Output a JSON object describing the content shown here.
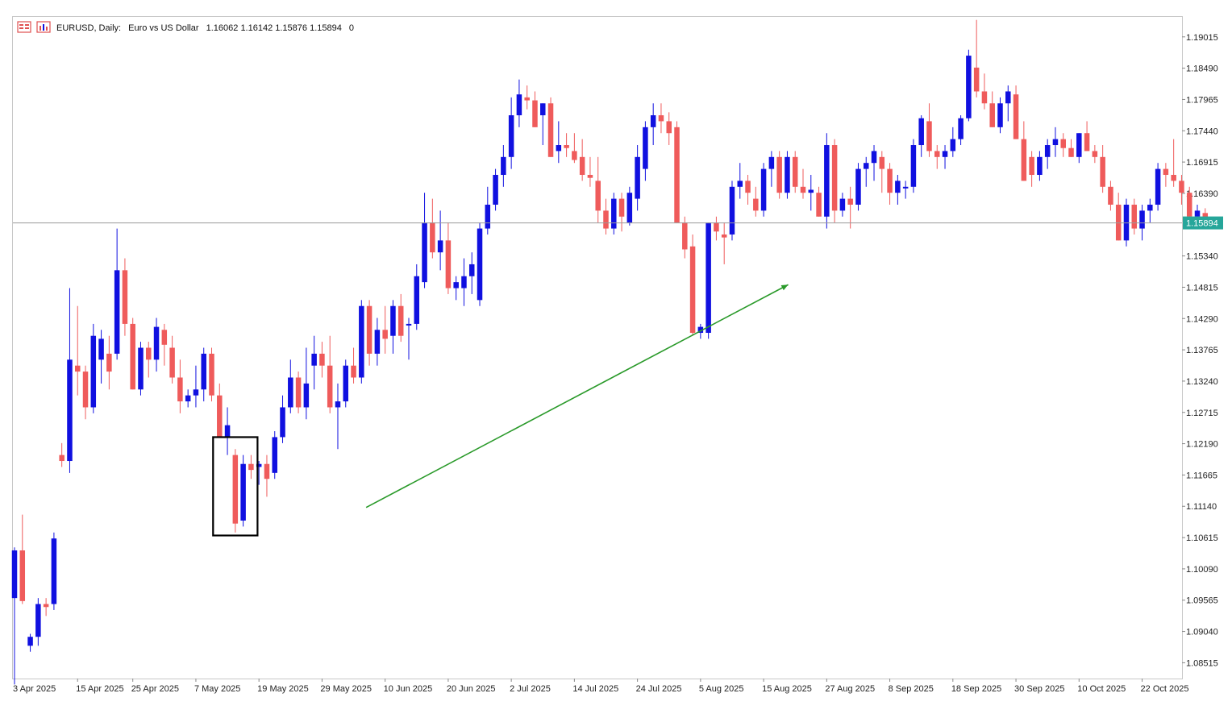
{
  "header": {
    "symbol_label": "EURUSD, Daily:",
    "description": "Euro vs US Dollar",
    "ohlc_text": "1.16062 1.16142 1.15876 1.15894",
    "volume_text": "0"
  },
  "icons": [
    "chart-menu-icon",
    "indicator-icon"
  ],
  "colors": {
    "bull": "#1010e0",
    "bear": "#ef5b5b",
    "price_line": "#9a9a9a",
    "price_label_bg": "#26a69a",
    "trend_arrow": "#2a9a2a",
    "highlight_box": "#000000"
  },
  "chart_data": {
    "type": "candlestick",
    "ylim": [
      1.0825,
      1.1935
    ],
    "y_ticks": [
      1.19015,
      1.1849,
      1.17965,
      1.1744,
      1.16915,
      1.1639,
      1.1534,
      1.14815,
      1.1429,
      1.13765,
      1.1324,
      1.12715,
      1.1219,
      1.11665,
      1.1114,
      1.10615,
      1.1009,
      1.09565,
      1.0904,
      1.08515
    ],
    "y_tick_labels": [
      "1.19015",
      "1.18490",
      "1.17965",
      "1.17440",
      "1.16915",
      "1.16390",
      "1.15340",
      "1.14815",
      "1.14290",
      "1.13765",
      "1.13240",
      "1.12715",
      "1.12190",
      "1.11665",
      "1.11140",
      "1.10615",
      "1.10090",
      "1.09565",
      "1.09040",
      "1.08515"
    ],
    "current_price": 1.15894,
    "current_price_label": "1.15894",
    "x_labels": [
      {
        "index": 0,
        "label": "3 Apr 2025"
      },
      {
        "index": 8,
        "label": "15 Apr 2025"
      },
      {
        "index": 15,
        "label": "25 Apr 2025"
      },
      {
        "index": 23,
        "label": "7 May 2025"
      },
      {
        "index": 31,
        "label": "19 May 2025"
      },
      {
        "index": 39,
        "label": "29 May 2025"
      },
      {
        "index": 47,
        "label": "10 Jun 2025"
      },
      {
        "index": 55,
        "label": "20 Jun 2025"
      },
      {
        "index": 63,
        "label": "2 Jul 2025"
      },
      {
        "index": 71,
        "label": "14 Jul 2025"
      },
      {
        "index": 79,
        "label": "24 Jul 2025"
      },
      {
        "index": 87,
        "label": "5 Aug 2025"
      },
      {
        "index": 95,
        "label": "15 Aug 2025"
      },
      {
        "index": 103,
        "label": "27 Aug 2025"
      },
      {
        "index": 111,
        "label": "8 Sep 2025"
      },
      {
        "index": 119,
        "label": "18 Sep 2025"
      },
      {
        "index": 127,
        "label": "30 Sep 2025"
      },
      {
        "index": 135,
        "label": "10 Oct 2025"
      },
      {
        "index": 143,
        "label": "22 Oct 2025"
      }
    ],
    "candles": [
      [
        1.096,
        1.1045,
        1.0815,
        1.104
      ],
      [
        1.104,
        1.11,
        1.095,
        1.0955
      ],
      [
        1.088,
        1.09,
        1.087,
        1.0895
      ],
      [
        1.0895,
        1.096,
        1.088,
        1.095
      ],
      [
        1.095,
        1.096,
        1.093,
        1.0945
      ],
      [
        1.095,
        1.107,
        1.094,
        1.106
      ],
      [
        1.12,
        1.122,
        1.118,
        1.119
      ],
      [
        1.119,
        1.148,
        1.117,
        1.136
      ],
      [
        1.135,
        1.145,
        1.13,
        1.134
      ],
      [
        1.134,
        1.135,
        1.126,
        1.128
      ],
      [
        1.128,
        1.142,
        1.127,
        1.14
      ],
      [
        1.136,
        1.141,
        1.132,
        1.1395
      ],
      [
        1.137,
        1.14,
        1.131,
        1.134
      ],
      [
        1.137,
        1.158,
        1.136,
        1.151
      ],
      [
        1.151,
        1.153,
        1.14,
        1.142
      ],
      [
        1.142,
        1.143,
        1.131,
        1.131
      ],
      [
        1.131,
        1.139,
        1.13,
        1.138
      ],
      [
        1.138,
        1.139,
        1.133,
        1.136
      ],
      [
        1.136,
        1.143,
        1.134,
        1.1415
      ],
      [
        1.141,
        1.142,
        1.135,
        1.1385
      ],
      [
        1.138,
        1.14,
        1.132,
        1.133
      ],
      [
        1.133,
        1.136,
        1.127,
        1.129
      ],
      [
        1.129,
        1.131,
        1.128,
        1.13
      ],
      [
        1.13,
        1.135,
        1.128,
        1.131
      ],
      [
        1.131,
        1.138,
        1.129,
        1.137
      ],
      [
        1.137,
        1.138,
        1.129,
        1.13
      ],
      [
        1.13,
        1.132,
        1.123,
        1.123
      ],
      [
        1.123,
        1.128,
        1.12,
        1.125
      ],
      [
        1.12,
        1.121,
        1.107,
        1.1085
      ],
      [
        1.109,
        1.12,
        1.108,
        1.1185
      ],
      [
        1.1185,
        1.12,
        1.116,
        1.1175
      ],
      [
        1.118,
        1.119,
        1.115,
        1.1185
      ],
      [
        1.1185,
        1.12,
        1.113,
        1.116
      ],
      [
        1.117,
        1.124,
        1.116,
        1.123
      ],
      [
        1.123,
        1.13,
        1.122,
        1.128
      ],
      [
        1.128,
        1.136,
        1.127,
        1.133
      ],
      [
        1.133,
        1.134,
        1.127,
        1.128
      ],
      [
        1.128,
        1.138,
        1.126,
        1.132
      ],
      [
        1.135,
        1.14,
        1.131,
        1.137
      ],
      [
        1.137,
        1.139,
        1.133,
        1.135
      ],
      [
        1.135,
        1.14,
        1.127,
        1.128
      ],
      [
        1.128,
        1.132,
        1.121,
        1.129
      ],
      [
        1.129,
        1.136,
        1.128,
        1.135
      ],
      [
        1.135,
        1.138,
        1.132,
        1.133
      ],
      [
        1.133,
        1.146,
        1.132,
        1.145
      ],
      [
        1.145,
        1.146,
        1.135,
        1.137
      ],
      [
        1.137,
        1.143,
        1.135,
        1.141
      ],
      [
        1.141,
        1.145,
        1.137,
        1.1395
      ],
      [
        1.14,
        1.146,
        1.137,
        1.145
      ],
      [
        1.145,
        1.147,
        1.139,
        1.14
      ],
      [
        1.142,
        1.143,
        1.136,
        1.142
      ],
      [
        1.142,
        1.152,
        1.141,
        1.15
      ],
      [
        1.149,
        1.164,
        1.148,
        1.159
      ],
      [
        1.159,
        1.163,
        1.153,
        1.154
      ],
      [
        1.154,
        1.161,
        1.151,
        1.156
      ],
      [
        1.156,
        1.159,
        1.147,
        1.148
      ],
      [
        1.148,
        1.15,
        1.146,
        1.149
      ],
      [
        1.148,
        1.153,
        1.145,
        1.15
      ],
      [
        1.15,
        1.154,
        1.147,
        1.152
      ],
      [
        1.146,
        1.159,
        1.145,
        1.158
      ],
      [
        1.158,
        1.165,
        1.157,
        1.162
      ],
      [
        1.162,
        1.168,
        1.161,
        1.167
      ],
      [
        1.167,
        1.172,
        1.165,
        1.17
      ],
      [
        1.17,
        1.18,
        1.168,
        1.177
      ],
      [
        1.177,
        1.183,
        1.175,
        1.1805
      ],
      [
        1.18,
        1.182,
        1.178,
        1.1795
      ],
      [
        1.1795,
        1.181,
        1.175,
        1.175
      ],
      [
        1.177,
        1.179,
        1.172,
        1.179
      ],
      [
        1.179,
        1.18,
        1.17,
        1.17
      ],
      [
        1.171,
        1.176,
        1.169,
        1.172
      ],
      [
        1.172,
        1.174,
        1.17,
        1.1715
      ],
      [
        1.171,
        1.174,
        1.169,
        1.1695
      ],
      [
        1.17,
        1.173,
        1.166,
        1.167
      ],
      [
        1.167,
        1.17,
        1.165,
        1.1665
      ],
      [
        1.166,
        1.17,
        1.159,
        1.161
      ],
      [
        1.161,
        1.163,
        1.157,
        1.158
      ],
      [
        1.158,
        1.164,
        1.157,
        1.163
      ],
      [
        1.163,
        1.164,
        1.1575,
        1.16
      ],
      [
        1.159,
        1.165,
        1.1585,
        1.164
      ],
      [
        1.163,
        1.172,
        1.161,
        1.17
      ],
      [
        1.168,
        1.176,
        1.166,
        1.175
      ],
      [
        1.175,
        1.179,
        1.172,
        1.177
      ],
      [
        1.177,
        1.179,
        1.174,
        1.176
      ],
      [
        1.176,
        1.1775,
        1.172,
        1.174
      ],
      [
        1.175,
        1.176,
        1.159,
        1.159
      ],
      [
        1.159,
        1.16,
        1.153,
        1.1545
      ],
      [
        1.155,
        1.157,
        1.14,
        1.1405
      ],
      [
        1.1405,
        1.142,
        1.1395,
        1.1415
      ],
      [
        1.1405,
        1.159,
        1.1395,
        1.159
      ],
      [
        1.159,
        1.16,
        1.156,
        1.1575
      ],
      [
        1.157,
        1.159,
        1.152,
        1.1565
      ],
      [
        1.157,
        1.166,
        1.156,
        1.165
      ],
      [
        1.165,
        1.169,
        1.163,
        1.166
      ],
      [
        1.166,
        1.167,
        1.162,
        1.164
      ],
      [
        1.163,
        1.165,
        1.16,
        1.161
      ],
      [
        1.161,
        1.169,
        1.16,
        1.168
      ],
      [
        1.168,
        1.171,
        1.165,
        1.17
      ],
      [
        1.17,
        1.171,
        1.163,
        1.164
      ],
      [
        1.164,
        1.171,
        1.163,
        1.17
      ],
      [
        1.17,
        1.171,
        1.164,
        1.165
      ],
      [
        1.165,
        1.168,
        1.163,
        1.164
      ],
      [
        1.164,
        1.167,
        1.161,
        1.1645
      ],
      [
        1.164,
        1.165,
        1.16,
        1.16
      ],
      [
        1.16,
        1.174,
        1.158,
        1.172
      ],
      [
        1.172,
        1.173,
        1.159,
        1.161
      ],
      [
        1.161,
        1.164,
        1.16,
        1.163
      ],
      [
        1.163,
        1.165,
        1.158,
        1.162
      ],
      [
        1.162,
        1.169,
        1.161,
        1.168
      ],
      [
        1.168,
        1.17,
        1.165,
        1.169
      ],
      [
        1.169,
        1.172,
        1.166,
        1.171
      ],
      [
        1.17,
        1.171,
        1.164,
        1.168
      ],
      [
        1.168,
        1.169,
        1.162,
        1.164
      ],
      [
        1.164,
        1.167,
        1.162,
        1.166
      ],
      [
        1.165,
        1.166,
        1.163,
        1.165
      ],
      [
        1.165,
        1.173,
        1.164,
        1.172
      ],
      [
        1.172,
        1.177,
        1.17,
        1.1765
      ],
      [
        1.176,
        1.179,
        1.17,
        1.171
      ],
      [
        1.171,
        1.172,
        1.168,
        1.17
      ],
      [
        1.17,
        1.172,
        1.168,
        1.171
      ],
      [
        1.171,
        1.175,
        1.17,
        1.173
      ],
      [
        1.173,
        1.177,
        1.172,
        1.1765
      ],
      [
        1.1765,
        1.188,
        1.176,
        1.187
      ],
      [
        1.185,
        1.193,
        1.18,
        1.181
      ],
      [
        1.181,
        1.184,
        1.178,
        1.179
      ],
      [
        1.179,
        1.181,
        1.175,
        1.175
      ],
      [
        1.175,
        1.18,
        1.174,
        1.179
      ],
      [
        1.179,
        1.182,
        1.176,
        1.181
      ],
      [
        1.1805,
        1.182,
        1.173,
        1.173
      ],
      [
        1.173,
        1.176,
        1.166,
        1.166
      ],
      [
        1.17,
        1.171,
        1.165,
        1.167
      ],
      [
        1.167,
        1.171,
        1.166,
        1.17
      ],
      [
        1.17,
        1.173,
        1.168,
        1.172
      ],
      [
        1.172,
        1.175,
        1.17,
        1.173
      ],
      [
        1.173,
        1.174,
        1.17,
        1.1715
      ],
      [
        1.1715,
        1.173,
        1.17,
        1.17
      ],
      [
        1.17,
        1.174,
        1.169,
        1.174
      ],
      [
        1.174,
        1.176,
        1.171,
        1.171
      ],
      [
        1.171,
        1.172,
        1.169,
        1.17
      ],
      [
        1.17,
        1.172,
        1.164,
        1.165
      ],
      [
        1.165,
        1.166,
        1.161,
        1.162
      ],
      [
        1.162,
        1.164,
        1.156,
        1.156
      ],
      [
        1.156,
        1.163,
        1.155,
        1.162
      ],
      [
        1.162,
        1.163,
        1.157,
        1.158
      ],
      [
        1.158,
        1.162,
        1.156,
        1.161
      ],
      [
        1.161,
        1.163,
        1.159,
        1.162
      ],
      [
        1.162,
        1.169,
        1.161,
        1.168
      ],
      [
        1.168,
        1.169,
        1.165,
        1.167
      ],
      [
        1.167,
        1.173,
        1.165,
        1.166
      ],
      [
        1.166,
        1.167,
        1.162,
        1.164
      ],
      [
        1.164,
        1.165,
        1.158,
        1.16
      ],
      [
        1.16,
        1.162,
        1.158,
        1.161
      ],
      [
        1.1606,
        1.1614,
        1.1588,
        1.1589
      ]
    ],
    "highlight_range": {
      "start_index": 26,
      "end_index": 30,
      "low": 1.1065,
      "high": 1.123
    },
    "trend_arrow": {
      "from_index": 54,
      "from_price": 1.1085,
      "to_index": 102,
      "to_price": 1.1475
    }
  }
}
